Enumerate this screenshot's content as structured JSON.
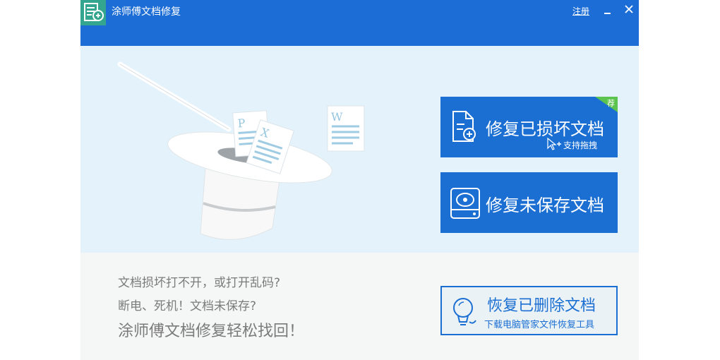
{
  "app": {
    "title": "涂师傅文档修复",
    "register_label": "注册",
    "accent_color": "#1c6ed6",
    "icon_color": "#34a58f"
  },
  "window_controls": {
    "minimize_icon": "minimize-icon",
    "close_icon": "close-icon"
  },
  "actions": {
    "repair_damaged": {
      "label": "修复已损坏文档",
      "drag_hint": "支持拖拽",
      "badge": "荐",
      "icon": "document-repair-icon"
    },
    "repair_unsaved": {
      "label": "修复未保存文档",
      "icon": "disk-drive-icon"
    },
    "recover_deleted": {
      "title": "恢复已删除文档",
      "subtitle": "下载电脑管家文件恢复工具",
      "icon": "lightbulb-icon"
    }
  },
  "promo": {
    "line1": "文档损坏打不开，或打开乱码?",
    "line2": "断电、死机！文档未保存?",
    "line3": "涂师傅文档修复轻松找回！"
  },
  "illustration": {
    "doc_letters": [
      "P",
      "X",
      "W"
    ]
  }
}
